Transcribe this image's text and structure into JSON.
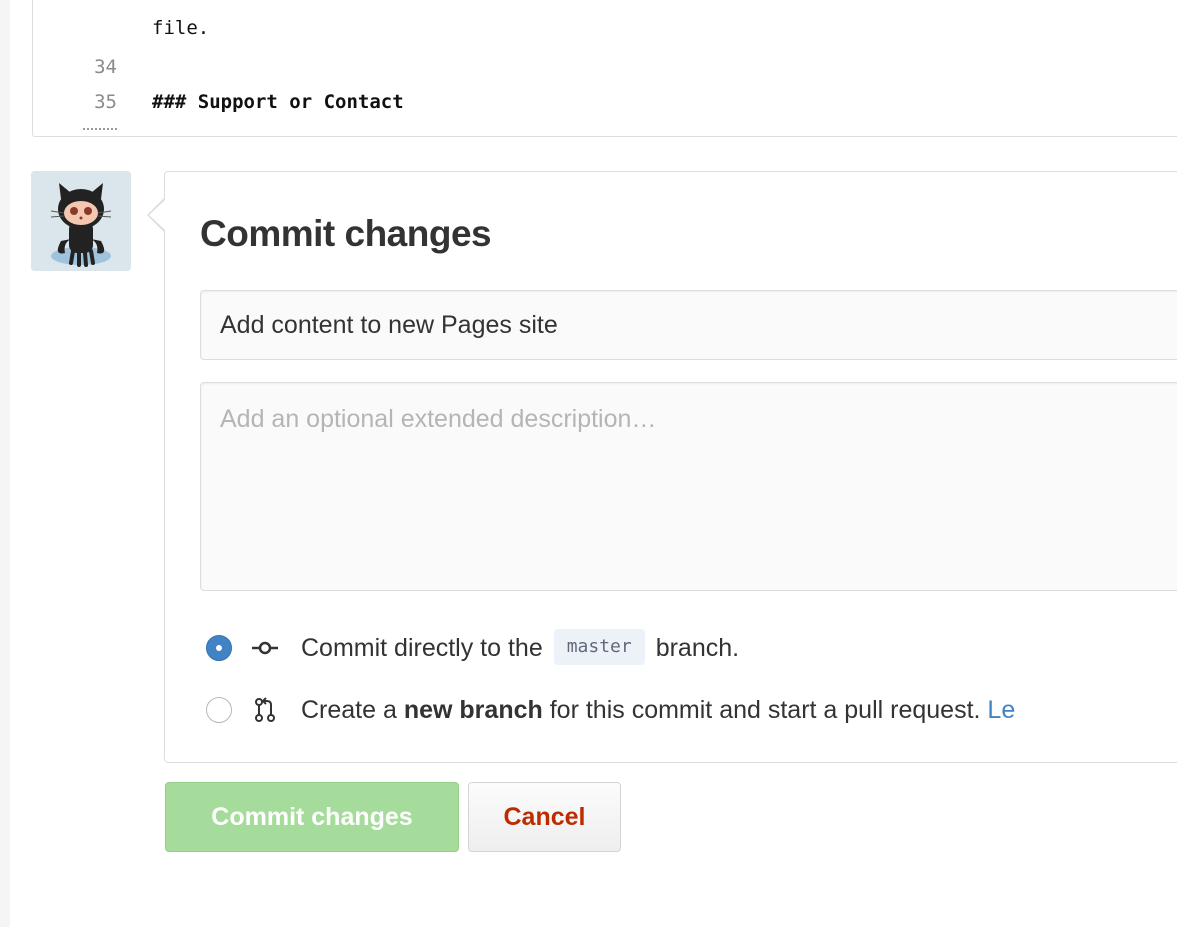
{
  "editor": {
    "lines": [
      {
        "num": "",
        "text": "file."
      },
      {
        "num": "34",
        "text": ""
      },
      {
        "num": "35",
        "text": "### Support or Contact"
      }
    ]
  },
  "avatar": {
    "icon": "octocat-avatar-icon"
  },
  "commit_form": {
    "title": "Commit changes",
    "summary_value": "Add content to new Pages site",
    "description_placeholder": "Add an optional extended description…"
  },
  "options": {
    "direct": {
      "prefix": "Commit directly to the",
      "branch": "master",
      "suffix": "branch.",
      "icon": "git-commit-icon",
      "selected": true
    },
    "new_branch": {
      "prefix": "Create a",
      "bold": "new branch",
      "suffix": "for this commit and start a pull request.",
      "link": "Le",
      "icon": "git-pull-request-icon",
      "selected": false
    }
  },
  "buttons": {
    "commit_label": "Commit changes",
    "cancel_label": "Cancel"
  },
  "colors": {
    "accent": "#4183c4",
    "primary_disabled": "#a6dc9b",
    "cancel_text": "#bd2c00"
  }
}
